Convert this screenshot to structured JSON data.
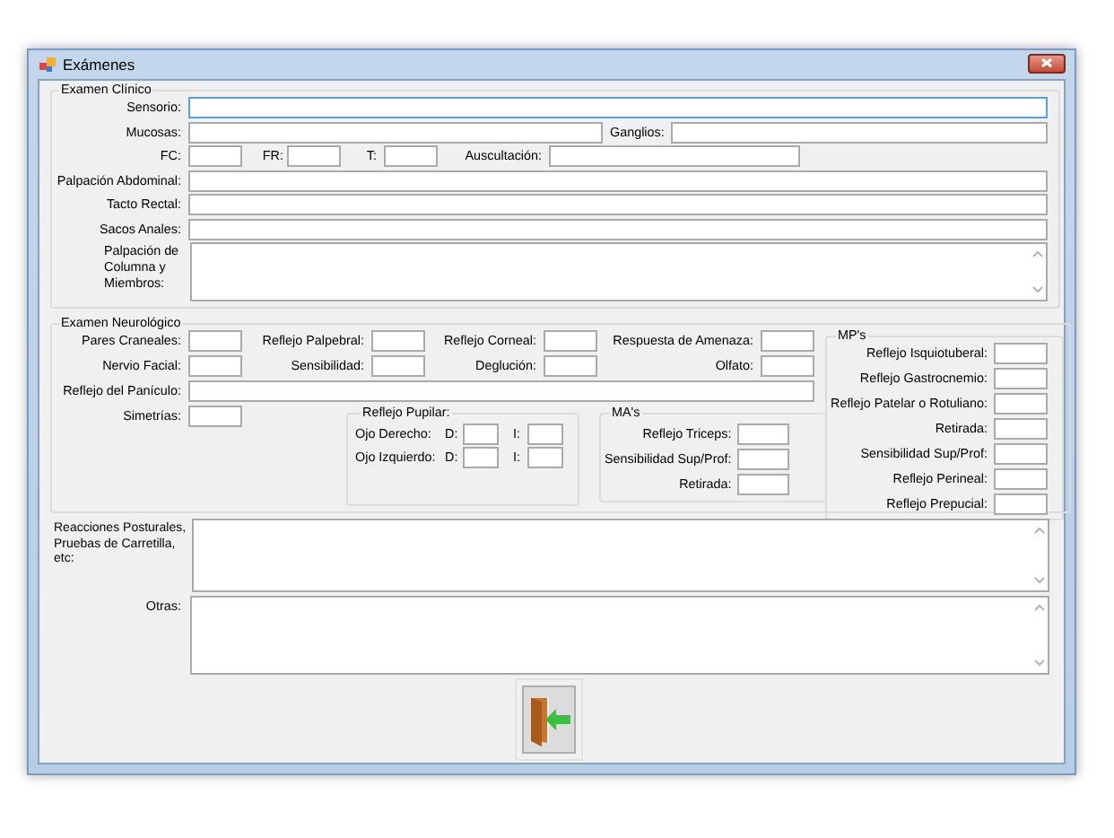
{
  "window": {
    "title": "Exámenes"
  },
  "examen_clinico": {
    "legend": "Examen Clínico",
    "fields": [
      {
        "label": "Sensorio:",
        "focused": true
      },
      {
        "label": "Mucosas:",
        "focused": false
      },
      {
        "label": "Ganglios:",
        "focused": false
      },
      {
        "label": "FC:",
        "focused": false
      },
      {
        "label": "FR:",
        "focused": false
      },
      {
        "label": "T:",
        "focused": false
      },
      {
        "label": "Auscultación:",
        "focused": false
      },
      {
        "label": "Palpación Abdominal:",
        "focused": false
      },
      {
        "label": "Tacto Rectal:",
        "focused": false
      },
      {
        "label": "Sacos Anales:",
        "focused": false
      },
      {
        "label": "Palpación de Columna y Miembros:",
        "focused": false
      }
    ]
  },
  "examen_neurologico": {
    "legend": "Examen Neurológico",
    "fields": [
      {
        "label": "Pares Craneales:"
      },
      {
        "label": "Reflejo Palpebral:"
      },
      {
        "label": "Reflejo Corneal:"
      },
      {
        "label": "Respuesta de Amenaza:"
      },
      {
        "label": "Nervio Facial:"
      },
      {
        "label": "Sensibilidad:"
      },
      {
        "label": "Deglución:"
      },
      {
        "label": "Olfato:"
      },
      {
        "label": "Reflejo del Panículo:"
      },
      {
        "label": "Simetrías:"
      }
    ],
    "reflejo_pupilar": {
      "legend": "Reflejo Pupilar:",
      "rows": [
        {
          "label": "Ojo Derecho:",
          "d": "D:",
          "i": "I:"
        },
        {
          "label": "Ojo Izquierdo:",
          "d": "D:",
          "i": "I:"
        }
      ]
    },
    "mas": {
      "legend": "MA's",
      "fields": [
        {
          "label": "Reflejo Triceps:"
        },
        {
          "label": "Sensibilidad Sup/Prof:"
        },
        {
          "label": "Retirada:"
        }
      ]
    },
    "mps": {
      "legend": "MP's",
      "fields": [
        {
          "label": "Reflejo Isquiotuberal:"
        },
        {
          "label": "Reflejo Gastrocnemio:"
        },
        {
          "label": "Reflejo Patelar o Rotuliano:"
        },
        {
          "label": "Retirada:"
        },
        {
          "label": "Sensibilidad Sup/Prof:"
        },
        {
          "label": "Reflejo Perineal:"
        },
        {
          "label": "Reflejo Prepucial:"
        }
      ]
    }
  },
  "reacciones": {
    "label": "Reacciones Posturales, Pruebas de Carretilla, etc:"
  },
  "otras": {
    "label": "Otras:"
  }
}
